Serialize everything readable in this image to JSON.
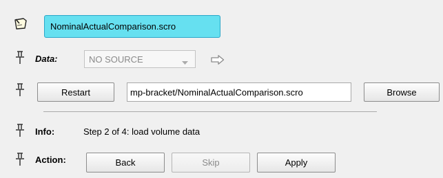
{
  "title_field": {
    "value": "NominalActualComparison.scro",
    "icon": "edit-note-icon"
  },
  "data_row": {
    "label": "Data:",
    "select_value": "NO SOURCE",
    "arrow_icon": "arrow-right-icon"
  },
  "file_row": {
    "restart_label": "Restart",
    "path_value": "mp-bracket/NominalActualComparison.scro",
    "browse_label": "Browse"
  },
  "info_row": {
    "label": "Info:",
    "text": "Step 2 of 4: load volume data"
  },
  "action_row": {
    "label": "Action:",
    "back_label": "Back",
    "skip_label": "Skip",
    "apply_label": "Apply"
  },
  "colors": {
    "title_field_bg": "#66e0f0",
    "title_field_border": "#2aa7c9"
  }
}
